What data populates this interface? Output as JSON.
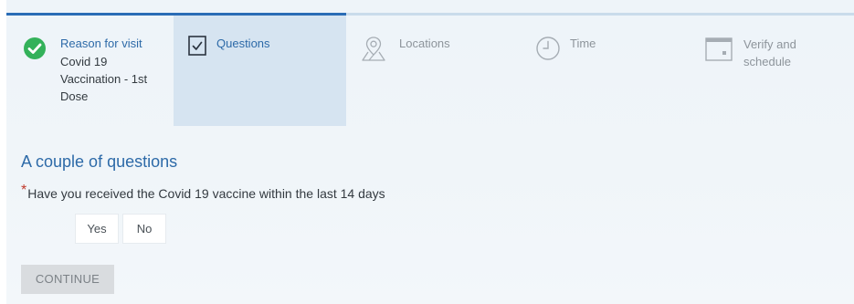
{
  "steps": [
    {
      "title": "Reason for visit",
      "detail": "Covid 19 Vaccination - 1st Dose",
      "icon": "check-circle-icon",
      "state": "completed"
    },
    {
      "title": "Questions",
      "icon": "checkbox-icon",
      "state": "current"
    },
    {
      "title": "Locations",
      "icon": "map-pin-icon",
      "state": "upcoming"
    },
    {
      "title": "Time",
      "icon": "clock-icon",
      "state": "upcoming"
    },
    {
      "title": "Verify and schedule",
      "icon": "calendar-icon",
      "state": "upcoming"
    }
  ],
  "form": {
    "heading": "A couple of questions",
    "required_marker": "*",
    "question": "Have you received the Covid 19 vaccine within the last 14 days",
    "options": [
      "Yes",
      "No"
    ],
    "submit_label": "CONTINUE"
  },
  "colors": {
    "accent": "#2a6cb6",
    "completed": "#33b15a",
    "current_step_bg": "#d6e4f1",
    "required": "#c0392b",
    "disabled_button": "#d9dcdf"
  }
}
